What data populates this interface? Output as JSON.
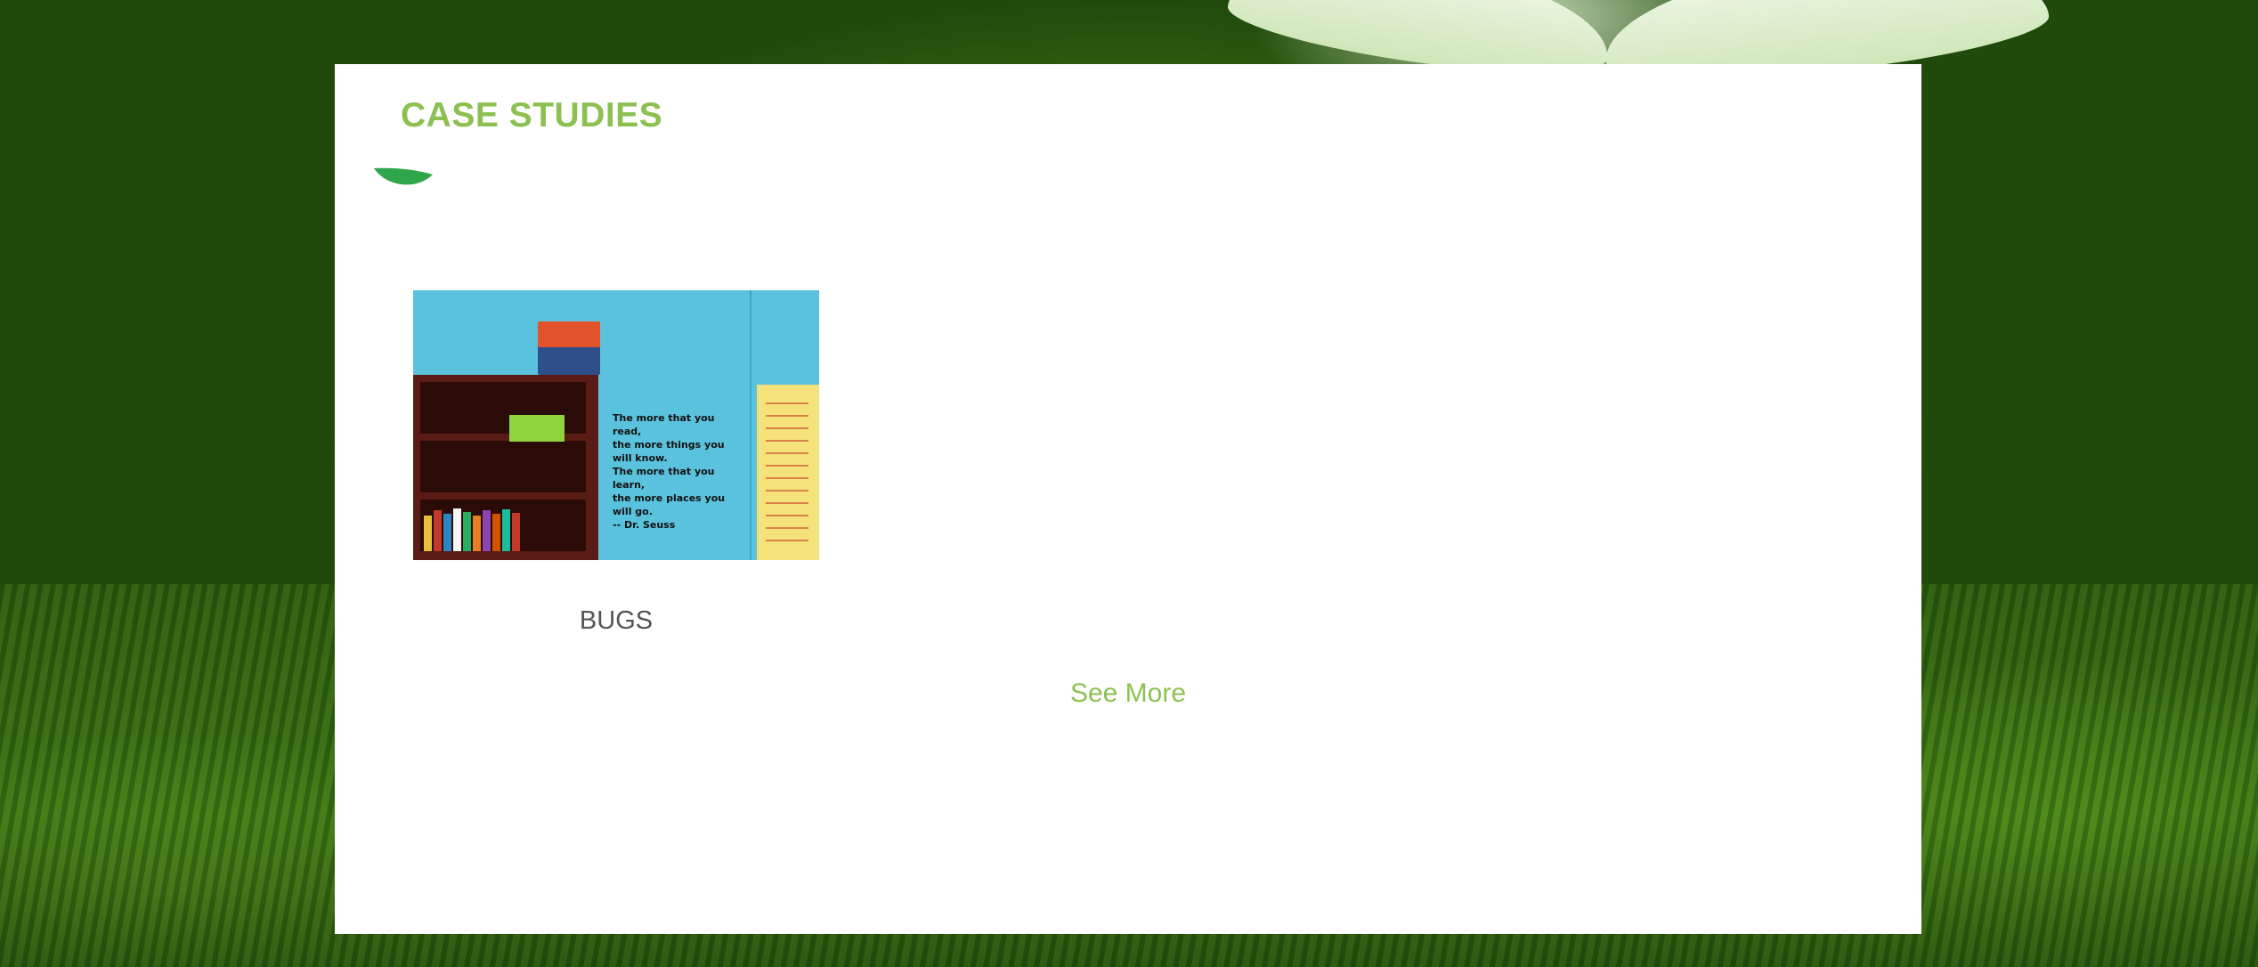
{
  "section": {
    "title": "CASE STUDIES",
    "icon": "leaf-icon"
  },
  "case_studies": [
    {
      "caption": "BUGS",
      "image": {
        "icon": "classroom-bookshelf-photo",
        "quote_text": "The more that you read,\nthe more things you will know.\nThe more that you learn,\nthe more places you will go.\n-- Dr. Seuss"
      }
    }
  ],
  "see_more_label": "See More",
  "colors": {
    "accent": "#8cc152",
    "caption": "#555555",
    "leaf": "#2fa64a",
    "panel": "#ffffff"
  }
}
